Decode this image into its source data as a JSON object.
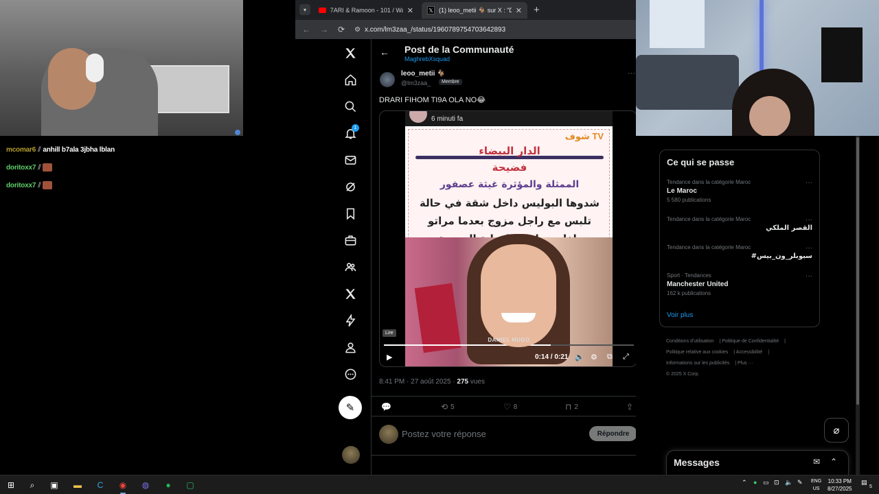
{
  "stream_chat": {
    "messages": [
      {
        "user": "mcomar6",
        "text": "anhill b7ala 3jbha lblan"
      },
      {
        "user": "doritoxx7",
        "text": ""
      },
      {
        "user": "doritoxx7",
        "text": ""
      }
    ]
  },
  "browser": {
    "tabs": [
      {
        "title": "7ARI & Ramoon - 101 / Wad A...",
        "active": false,
        "favicon": "youtube-icon"
      },
      {
        "title": "(1) leoo_metii 🐐 sur X : \"DRARI...",
        "active": true,
        "favicon": "x-icon"
      }
    ],
    "url": "x.com/lm3zaa_/status/1960789754703642893"
  },
  "x_nav": {
    "notification_count": "1",
    "items": [
      "x-logo",
      "home",
      "explore",
      "notifications",
      "messages",
      "grok",
      "bookmarks",
      "jobs",
      "communities",
      "premium",
      "verified-orgs",
      "profile",
      "more"
    ]
  },
  "post": {
    "header_title": "Post de la Communauté",
    "header_sub": "MaghrebXsquad",
    "author_name": "leoo_metii 🐐",
    "author_handle": "@lm3zaa_",
    "member_badge": "Membre",
    "text": "DRARI FIHOM TI9A OLA NO😂",
    "media": {
      "time_ago": "6 minuti fa",
      "brand": "شوف TV",
      "ar_title_1": "الدار البيضاء",
      "ar_title_2": "فضيحة",
      "ar_line_1": "الممثلة والمؤثرة غيثة عصفور",
      "ar_line_2": "شدوها البوليس داخل شقة في حالة",
      "ar_line_3": "تلبس مع راجل مزوج بعدما مراتو",
      "ar_line_4": "بلغات بواقعة الخيانة الزوجية",
      "credit": "DANIEL HUGO",
      "tooltip": "Lire",
      "timecode": "0:14 / 0:21",
      "progress": 0.667
    },
    "timestamp": "8:41 PM · 27 août 2025 · ",
    "views_count": "275",
    "views_label": " vues",
    "actions": {
      "reposts": "5",
      "likes": "8",
      "bookmarks": "2"
    },
    "reply_placeholder": "Postez votre réponse",
    "reply_button": "Répondre"
  },
  "sidebar": {
    "trends_title": "Ce qui se passe",
    "trends": [
      {
        "context": "Tendance dans la catégorie Maroc",
        "name": "Le Maroc",
        "count": "5 580 publications",
        "rtl": false
      },
      {
        "context": "Tendance dans la catégorie Maroc",
        "name": "القصر الملكي",
        "count": "",
        "rtl": true
      },
      {
        "context": "Tendance dans la catégorie Maroc",
        "name": "#سبوبلر_ون_بيس",
        "count": "",
        "rtl": true
      },
      {
        "context": "Sport · Tendances",
        "name": "Manchester United",
        "count": "162 k publications",
        "rtl": false
      }
    ],
    "show_more": "Voir plus",
    "footer": [
      "Conditions d'utilisation",
      "Politique de Confidentialité",
      "Politique relative aux cookies",
      "Accessibilité",
      "Informations sur les publicités",
      "Plus ···",
      "© 2025 X Corp."
    ],
    "messages_title": "Messages"
  },
  "taskbar": {
    "lang_1": "ENG",
    "lang_2": "US",
    "time": "10:33 PM",
    "date": "8/27/2025",
    "notification_count": "5"
  },
  "colors": {
    "accent": "#1d9bf0",
    "border": "#2f3336",
    "muted": "#71767b"
  }
}
